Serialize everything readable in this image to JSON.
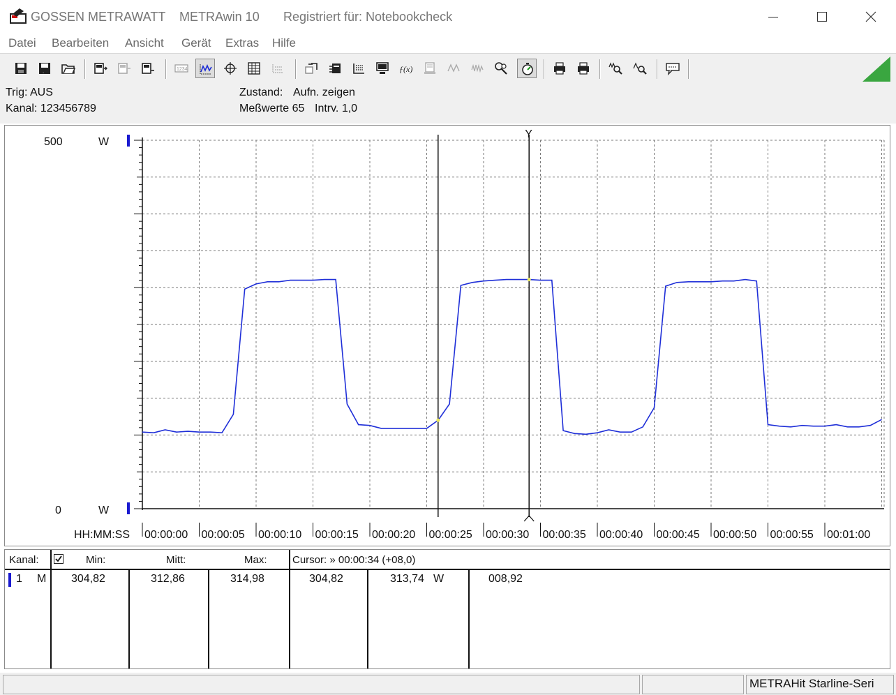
{
  "window": {
    "brand": "GOSSEN METRAWATT",
    "app": "METRAwin 10",
    "registered": "Registriert für: Notebookcheck"
  },
  "menu": [
    "Datei",
    "Bearbeiten",
    "Ansicht",
    "Gerät",
    "Extras",
    "Hilfe"
  ],
  "info": {
    "trig": "Trig: AUS",
    "kanal": "Kanal: 123456789",
    "zustand_label": "Zustand:",
    "zustand_value": "Aufn. zeigen",
    "messwerte": "Meßwerte 65",
    "intrv": "Intrv. 1,0"
  },
  "plot": {
    "y_max_label": "500",
    "y_min_label": "0",
    "unit": "W",
    "time_label": "HH:MM:SS"
  },
  "chart_data": {
    "type": "line",
    "ylim": [
      0,
      500
    ],
    "xlim": [
      0,
      64
    ],
    "x_tick_labels": [
      "00:00:00",
      "00:00:05",
      "00:00:10",
      "00:00:15",
      "00:00:20",
      "00:00:25",
      "00:00:30",
      "00:00:35",
      "00:00:40",
      "00:00:45",
      "00:00:50",
      "00:00:55",
      "00:01:00"
    ],
    "series": [
      {
        "color": "#1f2fd8",
        "values": [
          104,
          103,
          107,
          104,
          105,
          104,
          104,
          103,
          128,
          298,
          305,
          308,
          308,
          310,
          310,
          310,
          311,
          311,
          142,
          114,
          113,
          109,
          109,
          109,
          109,
          109,
          120,
          142,
          303,
          307,
          309,
          310,
          311,
          311,
          311,
          310,
          310,
          106,
          102,
          101,
          103,
          107,
          104,
          104,
          111,
          137,
          302,
          307,
          308,
          308,
          308,
          309,
          309,
          311,
          309,
          114,
          112,
          111,
          113,
          112,
          112,
          114,
          111,
          111,
          113,
          121
        ]
      }
    ],
    "cursors": [
      {
        "x": 26,
        "label": ""
      },
      {
        "x": 34,
        "label": "Y"
      }
    ],
    "grid": true
  },
  "table": {
    "headers": {
      "kanal": "Kanal:",
      "min": "Min:",
      "mitt": "Mitt:",
      "max": "Max:",
      "cursor": "Cursor: » 00:00:34 (+08,0)"
    },
    "row": {
      "channel": "1",
      "mode": "M",
      "min": "304,82",
      "mitt": "312,86",
      "max": "314,98",
      "cursor_val1": "304,82",
      "cursor_val2": "313,74",
      "unit": "W",
      "diff": "008,92"
    }
  },
  "status": {
    "device": "METRAHit Starline-Seri"
  }
}
